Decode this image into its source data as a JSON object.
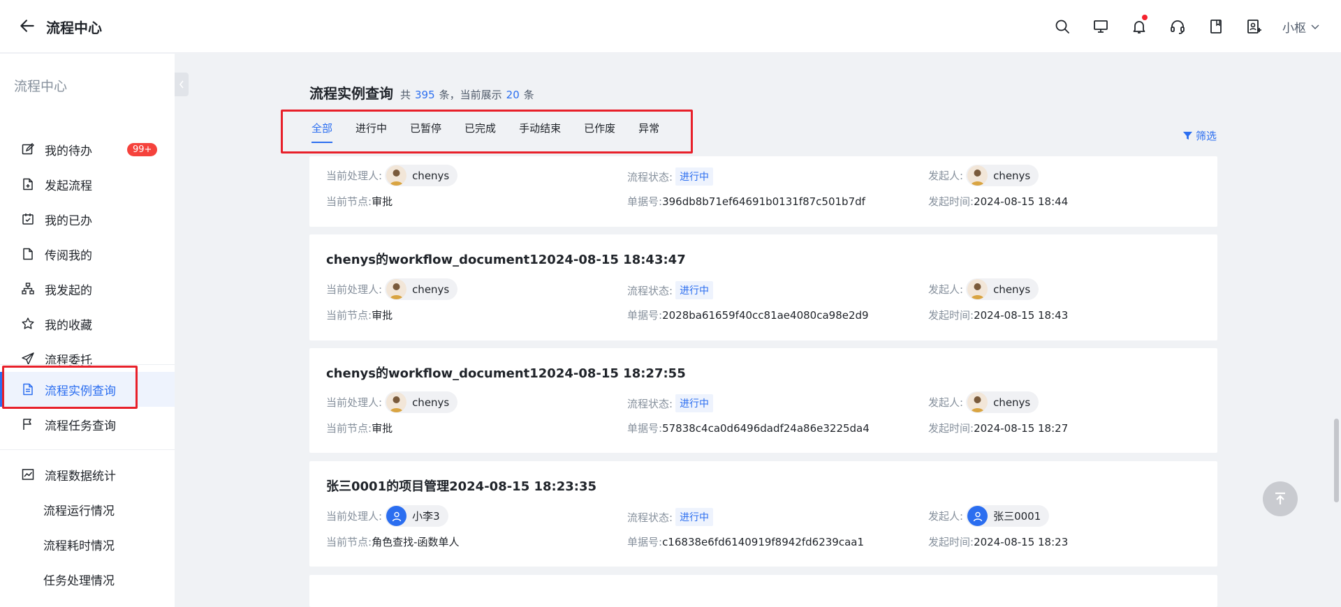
{
  "header": {
    "back_icon": "arrow-left-icon",
    "title": "流程中心",
    "icons": [
      "search-icon",
      "monitor-icon",
      "bell-icon",
      "headset-icon",
      "book-icon",
      "user-add-icon"
    ],
    "user_name": "小枢"
  },
  "sidebar": {
    "heading": "流程中心",
    "items": [
      {
        "label": "我的待办",
        "icon": "edit-icon",
        "badge": "99+"
      },
      {
        "label": "发起流程",
        "icon": "file-add-icon"
      },
      {
        "label": "我的已办",
        "icon": "calendar-check-icon"
      },
      {
        "label": "传阅我的",
        "icon": "file-icon"
      },
      {
        "label": "我发起的",
        "icon": "org-chart-icon"
      },
      {
        "label": "我的收藏",
        "icon": "star-icon"
      },
      {
        "label": "流程委托",
        "icon": "send-icon"
      },
      {
        "label": "流程实例查询",
        "icon": "file-text-icon",
        "active": true
      },
      {
        "label": "流程任务查询",
        "icon": "flag-icon"
      },
      {
        "label": "流程数据统计",
        "icon": "chart-icon"
      },
      {
        "label": "流程运行情况"
      },
      {
        "label": "流程耗时情况"
      },
      {
        "label": "任务处理情况"
      }
    ]
  },
  "main": {
    "title": "流程实例查询",
    "count_prefix": "共",
    "total": "395",
    "count_mid": "条，当前展示",
    "shown": "20",
    "count_suffix": "条",
    "tabs": [
      "全部",
      "进行中",
      "已暂停",
      "已完成",
      "手动结束",
      "已作废",
      "异常"
    ],
    "filter_label": "筛选",
    "labels": {
      "handler": "当前处理人:",
      "node": "当前节点:",
      "status": "流程状态:",
      "doc_no": "单据号:",
      "initiator": "发起人:",
      "start_time": "发起时间:"
    },
    "cards": [
      {
        "title": "",
        "handler": "chenys",
        "node": "审批",
        "status": "进行中",
        "doc_no": "396db8b71ef64691b0131f87c501b7df",
        "initiator": "chenys",
        "start_time": "2024-08-15 18:44"
      },
      {
        "title": "chenys的workflow_document12024-08-15 18:43:47",
        "handler": "chenys",
        "node": "审批",
        "status": "进行中",
        "doc_no": "2028ba61659f40cc81ae4080ca98e2d9",
        "initiator": "chenys",
        "start_time": "2024-08-15 18:43"
      },
      {
        "title": "chenys的workflow_document12024-08-15 18:27:55",
        "handler": "chenys",
        "node": "审批",
        "status": "进行中",
        "doc_no": "57838c4ca0d6496dadf24a86e3225da4",
        "initiator": "chenys",
        "start_time": "2024-08-15 18:27"
      },
      {
        "title": "张三0001的项目管理2024-08-15 18:23:35",
        "handler": "小李3",
        "node": "角色查找-函数单人",
        "status": "进行中",
        "doc_no": "c16838e6fd6140919f8942fd6239caa1",
        "initiator": "张三0001",
        "start_time": "2024-08-15 18:23"
      }
    ]
  },
  "colors": {
    "accent": "#2b6ef0",
    "badge": "#f5423c",
    "highlight_box": "#e8202a"
  }
}
